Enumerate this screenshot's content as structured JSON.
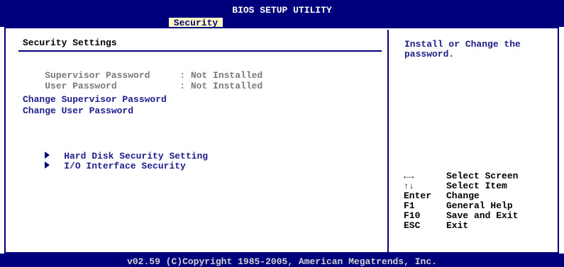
{
  "header": {
    "title": "BIOS SETUP UTILITY",
    "active_tab": "Security"
  },
  "main": {
    "section_title": "Security Settings",
    "fields": [
      {
        "label": "Supervisor Password",
        "value": ": Not Installed"
      },
      {
        "label": "User Password",
        "value": ": Not Installed"
      }
    ],
    "links": [
      "Change Supervisor Password",
      "Change User Password"
    ],
    "submenus": [
      "Hard Disk Security Setting",
      "I/O Interface Security"
    ]
  },
  "help": {
    "text": "Install or Change the password."
  },
  "keys": [
    {
      "key": "←→",
      "action": "Select Screen"
    },
    {
      "key": "↑↓",
      "action": "Select Item"
    },
    {
      "key": "Enter",
      "action": "Change"
    },
    {
      "key": "F1",
      "action": "General Help"
    },
    {
      "key": "F10",
      "action": "Save and Exit"
    },
    {
      "key": "ESC",
      "action": "Exit"
    }
  ],
  "footer": {
    "copyright": "v02.59 (C)Copyright 1985-2005, American Megatrends, Inc."
  },
  "colors": {
    "background_blue": "#00007d",
    "tab_highlight": "#fdfbc4",
    "link_blue": "#1d1d8c",
    "disabled_gray": "#7a7a7a"
  },
  "icons": {
    "submenu_marker": "triangle-right-icon",
    "lr_arrows": "left-right-arrows-icon",
    "ud_arrows": "up-down-arrows-icon"
  }
}
